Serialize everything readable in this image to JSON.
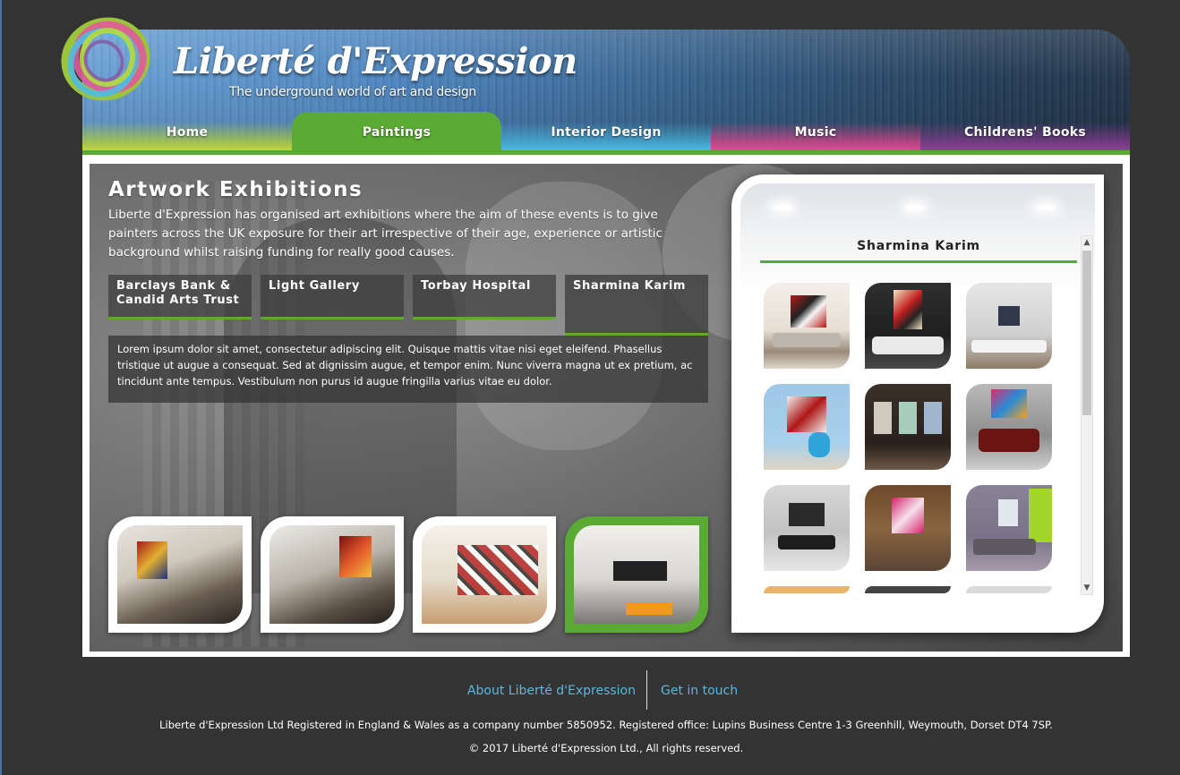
{
  "header": {
    "brand_title": "Liberté d'Expression",
    "brand_tagline": "The underground world of art and design",
    "logo_icon": "paint-swirl-logo-icon"
  },
  "nav": {
    "items": [
      {
        "label": "Home",
        "color": "#c8dc3c"
      },
      {
        "label": "Paintings",
        "color": "#5aaa33",
        "active": true
      },
      {
        "label": "Interior  Design",
        "color": "#4fc0e6"
      },
      {
        "label": "Music",
        "color": "#e0509a"
      },
      {
        "label": "Childrens'  Books",
        "color": "#8c4a98"
      }
    ]
  },
  "exhibitions": {
    "title": "Artwork  Exhibitions",
    "description": "Liberte d'Expression has organised art exhibitions where the aim of these events is to give painters across the UK exposure for their art irrespective of their age, experience or artistic background whilst raising funding for really good causes.",
    "venues": [
      {
        "label": "Barclays  Bank  &  Candid  Arts  Trust"
      },
      {
        "label": "Light  Gallery"
      },
      {
        "label": "Torbay  Hospital"
      },
      {
        "label": "Sharmina  Karim",
        "active": true
      }
    ],
    "detail_text": "Lorem ipsum dolor sit amet, consectetur adipiscing elit. Quisque mattis vitae nisi eget eleifend. Phasellus tristique ut augue a consequat. Sed at dignissim augue, et tempor enim. Nunc viverra magna ut ex pretium, ac tincidunt ante tempus. Vestibulum non purus id augue fringilla varius vitae eu dolor."
  },
  "gallery_panel": {
    "title": "Sharmina  Karim",
    "accent": "#5aaa33"
  },
  "footer": {
    "about_link": "About Liberté d'Expression",
    "contact_link": "Get in touch",
    "registration": "Liberte d'Expression Ltd Registered in England & Wales as a company number 5850952. Registered office: Lupins Business Centre 1-3 Greenhill, Weymouth, Dorset DT4 7SP.",
    "copyright": "© 2017 Liberté d'Expression Ltd., All rights reserved.",
    "link_color": "#5bb8e0"
  },
  "colors": {
    "page_bg": "#333333",
    "accent_green": "#5aaa33"
  }
}
